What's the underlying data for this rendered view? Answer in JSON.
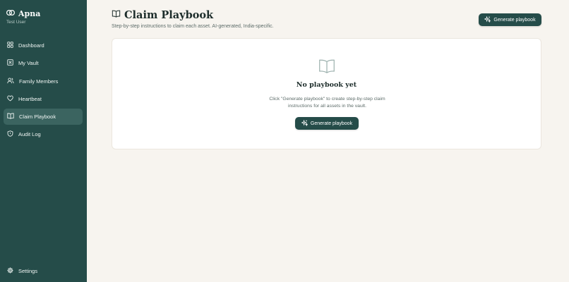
{
  "app": {
    "name": "Apna",
    "user": "Test User"
  },
  "sidebar": {
    "items": [
      {
        "label": "Dashboard",
        "icon": "grid-icon",
        "active": false
      },
      {
        "label": "My Vault",
        "icon": "vault-icon",
        "active": false
      },
      {
        "label": "Family Members",
        "icon": "users-icon",
        "active": false
      },
      {
        "label": "Heartbeat",
        "icon": "heart-icon",
        "active": false
      },
      {
        "label": "Claim Playbook",
        "icon": "book-icon",
        "active": true
      },
      {
        "label": "Audit Log",
        "icon": "shield-icon",
        "active": false
      }
    ],
    "settings_label": "Settings"
  },
  "header": {
    "title": "Claim Playbook",
    "subtitle": "Step-by-step instructions to claim each asset. AI-generated, India-specific.",
    "generate_label": "Generate playbook"
  },
  "empty_state": {
    "title": "No playbook yet",
    "description": "Click \"Generate playbook\" to create step-by-step claim instructions for all assets in the vault.",
    "button_label": "Generate playbook"
  },
  "colors": {
    "sidebar_bg": "#254c49",
    "sidebar_active": "#3b6460",
    "page_bg": "#f7f4ef",
    "accent": "#254c49"
  }
}
